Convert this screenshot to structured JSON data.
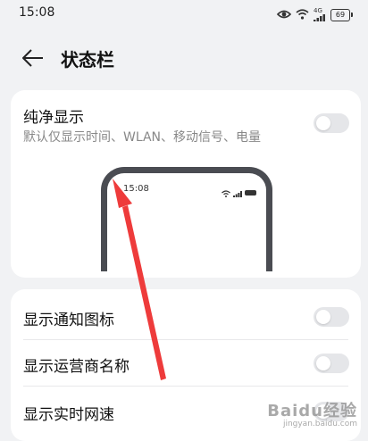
{
  "status_bar": {
    "time": "15:08",
    "network_tag": "4G",
    "battery_level": "69"
  },
  "header": {
    "title": "状态栏"
  },
  "pure_display": {
    "title": "纯净显示",
    "subtitle": "默认仅显示时间、WLAN、移动信号、电量",
    "enabled": false,
    "preview_time": "15:08"
  },
  "settings": [
    {
      "label": "显示通知图标",
      "enabled": false
    },
    {
      "label": "显示运营商名称",
      "enabled": false
    },
    {
      "label": "显示实时网速",
      "enabled": false
    }
  ],
  "watermark": {
    "logo": "Baidu经验",
    "url": "jingyan.baidu.com"
  },
  "colors": {
    "background": "#f1f2f4",
    "card": "#ffffff",
    "toggle_off": "#e5e6e9",
    "annotation_arrow": "#ee3b3b"
  }
}
